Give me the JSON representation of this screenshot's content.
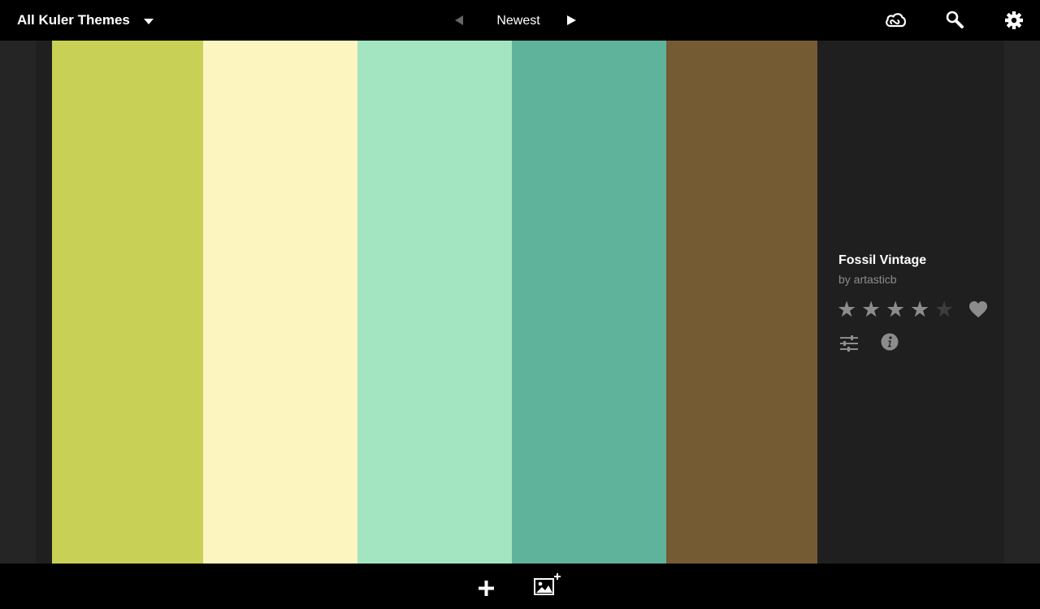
{
  "header": {
    "collection_title": "All Kuler Themes",
    "sort_label": "Newest"
  },
  "theme": {
    "name": "Fossil Vintage",
    "author": "by artasticb",
    "rating": 4,
    "max_rating": 5,
    "swatches": [
      {
        "color": "#C8D055"
      },
      {
        "color": "#FCF5C0"
      },
      {
        "color": "#A3E5C1"
      },
      {
        "color": "#5FB39B"
      },
      {
        "color": "#755B33"
      }
    ]
  },
  "icons": {
    "creative_cloud": "creative-cloud-icon",
    "search": "search-icon",
    "settings": "gear-icon",
    "favorite": "heart-icon",
    "edit": "sliders-icon",
    "info": "info-icon",
    "add": "plus-icon",
    "add_from_image": "image-plus-icon"
  },
  "colors": {
    "star_filled": "#8c8c8c",
    "star_empty": "#3d3d3d",
    "panel_bg": "#1f1f1f"
  }
}
